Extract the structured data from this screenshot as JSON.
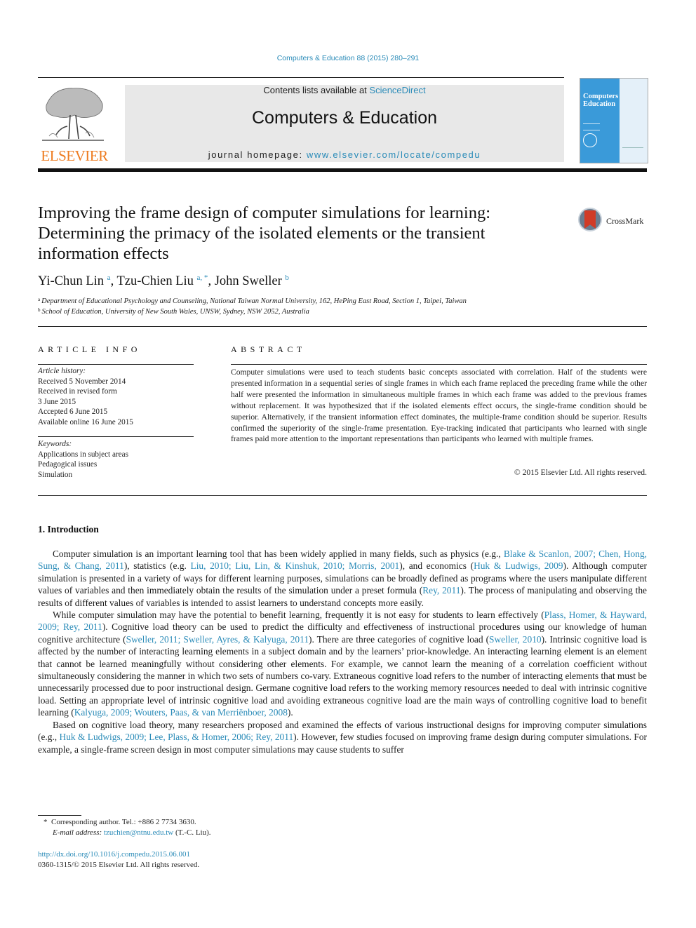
{
  "header": {
    "running_head": "Computers & Education 88 (2015) 280–291",
    "contents_prefix": "Contents lists available at ",
    "contents_link": "ScienceDirect",
    "journal_title": "Computers & Education",
    "homepage_prefix": "journal homepage: ",
    "homepage_link": "www.elsevier.com/locate/compedu",
    "publisher_logo_text": "ELSEVIER",
    "cover_title_line1": "Computers",
    "cover_title_amp": "&",
    "cover_title_line2": "Education",
    "crossmark_label": "CrossMark"
  },
  "article": {
    "title": "Improving the frame design of computer simulations for learning: Determining the primacy of the isolated elements or the transient information effects",
    "authors": [
      {
        "name": "Yi-Chun Lin",
        "sup": "a"
      },
      {
        "name": "Tzu-Chien Liu",
        "sup": "a, *"
      },
      {
        "name": "John Sweller",
        "sup": "b"
      }
    ],
    "affiliations": [
      {
        "mark": "a",
        "text": "Department of Educational Psychology and Counseling, National Taiwan Normal University, 162, HePing East Road, Section 1, Taipei, Taiwan"
      },
      {
        "mark": "b",
        "text": "School of Education, University of New South Wales, UNSW, Sydney, NSW 2052, Australia"
      }
    ]
  },
  "article_info": {
    "heading": "ARTICLE INFO",
    "history_label": "Article history:",
    "history": [
      "Received 5 November 2014",
      "Received in revised form",
      "3 June 2015",
      "Accepted 6 June 2015",
      "Available online 16 June 2015"
    ],
    "keywords_label": "Keywords:",
    "keywords": [
      "Applications in subject areas",
      "Pedagogical issues",
      "Simulation"
    ]
  },
  "abstract": {
    "heading": "ABSTRACT",
    "text": "Computer simulations were used to teach students basic concepts associated with correlation. Half of the students were presented information in a sequential series of single frames in which each frame replaced the preceding frame while the other half were presented the information in simultaneous multiple frames in which each frame was added to the previous frames without replacement. It was hypothesized that if the isolated elements effect occurs, the single-frame condition should be superior. Alternatively, if the transient information effect dominates, the multiple-frame condition should be superior. Results confirmed the superiority of the single-frame presentation. Eye-tracking indicated that participants who learned with single frames paid more attention to the important representations than participants who learned with multiple frames.",
    "copyright": "© 2015 Elsevier Ltd. All rights reserved."
  },
  "body": {
    "section_heading": "1.  Introduction",
    "paragraphs": [
      [
        {
          "t": "Computer simulation is an important learning tool that has been widely applied in many fields, such as physics (e.g., "
        },
        {
          "l": "Blake & Scanlon, 2007; Chen, Hong, Sung, & Chang, 2011"
        },
        {
          "t": "), statistics (e.g. "
        },
        {
          "l": "Liu, 2010; Liu, Lin, & Kinshuk, 2010; Morris, 2001"
        },
        {
          "t": "), and economics ("
        },
        {
          "l": "Huk & Ludwigs, 2009"
        },
        {
          "t": "). Although computer simulation is presented in a variety of ways for different learning purposes, simulations can be broadly defined as programs where the users manipulate different values of variables and then immediately obtain the results of the simulation under a preset formula ("
        },
        {
          "l": "Rey, 2011"
        },
        {
          "t": "). The process of manipulating and observing the results of different values of variables is intended to assist learners to understand concepts more easily."
        }
      ],
      [
        {
          "t": "While computer simulation may have the potential to benefit learning, frequently it is not easy for students to learn effectively ("
        },
        {
          "l": "Plass, Homer, & Hayward, 2009; Rey, 2011"
        },
        {
          "t": "). Cognitive load theory can be used to predict the difficulty and effectiveness of instructional procedures using our knowledge of human cognitive architecture ("
        },
        {
          "l": "Sweller, 2011; Sweller, Ayres, & Kalyuga, 2011"
        },
        {
          "t": "). There are three categories of cognitive load ("
        },
        {
          "l": "Sweller, 2010"
        },
        {
          "t": "). Intrinsic cognitive load is affected by the number of interacting learning elements in a subject domain and by the learners’ prior-knowledge. An interacting learning element is an element that cannot be learned meaningfully without considering other elements. For example, we cannot learn the meaning of a correlation coefficient without simultaneously considering the manner in which two sets of numbers co-vary. Extraneous cognitive load refers to the number of interacting elements that must be unnecessarily processed due to poor instructional design. Germane cognitive load refers to the working memory resources needed to deal with intrinsic cognitive load. Setting an appropriate level of intrinsic cognitive load and avoiding extraneous cognitive load are the main ways of controlling cognitive load to benefit learning ("
        },
        {
          "l": "Kalyuga, 2009; Wouters, Paas, & van Merriënboer, 2008"
        },
        {
          "t": ")."
        }
      ],
      [
        {
          "t": "Based on cognitive load theory, many researchers proposed and examined the effects of various instructional designs for improving computer simulations (e.g., "
        },
        {
          "l": "Huk & Ludwigs, 2009; Lee, Plass, & Homer, 2006; Rey, 2011"
        },
        {
          "t": "). However, few studies focused on improving frame design during computer simulations. For example, a single-frame screen design in most computer simulations may cause students to suffer"
        }
      ]
    ]
  },
  "footer": {
    "corresponding_mark": "*",
    "corresponding": "Corresponding author. Tel.: +886 2 7734 3630.",
    "email_label": "E-mail address:",
    "email": "tzuchien@ntnu.edu.tw",
    "email_suffix": " (T.-C. Liu).",
    "doi": "http://dx.doi.org/10.1016/j.compedu.2015.06.001",
    "issn": "0360-1315/© 2015 Elsevier Ltd. All rights reserved."
  },
  "colors": {
    "link": "#2a8bb8",
    "elsevier_orange": "#ee7b1f",
    "masthead_bg": "#e8e8e8",
    "cover_blue": "#3a9ad9"
  }
}
